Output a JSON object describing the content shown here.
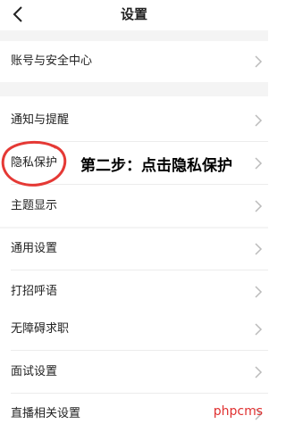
{
  "header": {
    "title": "设置"
  },
  "settings": {
    "items": [
      {
        "label": "账号与安全中心"
      },
      {
        "label": "通知与提醒"
      },
      {
        "label": "隐私保护"
      },
      {
        "label": "主题显示"
      },
      {
        "label": "通用设置"
      },
      {
        "label": "打招呼语"
      },
      {
        "label": "无障碍求职"
      },
      {
        "label": "面试设置"
      },
      {
        "label": "直播相关设置"
      }
    ]
  },
  "annotation": {
    "text": "第二步：点击隐私保护",
    "color": "#e53935"
  },
  "watermark": {
    "text": "phpcms",
    "color": "#e03030"
  },
  "icons": {
    "back": "chevron-left-icon",
    "row": "chevron-right-icon"
  }
}
